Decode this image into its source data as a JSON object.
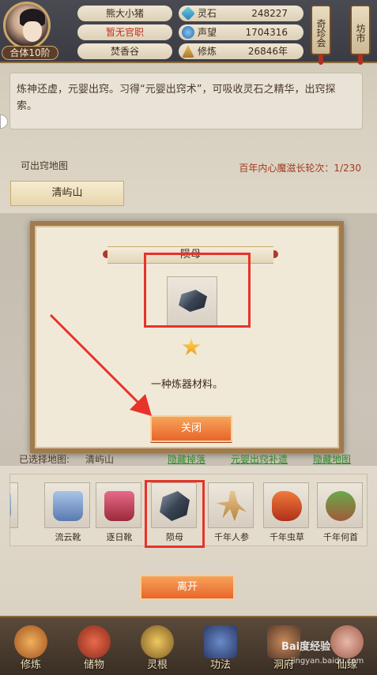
{
  "player": {
    "level": "合体10阶",
    "name": "熊大小猪",
    "title": "暂无官职",
    "sect": "焚香谷"
  },
  "resources": {
    "lingshi": {
      "label": "灵石",
      "value": "248227",
      "icon": "spirit-stone-icon"
    },
    "shengwang": {
      "label": "声望",
      "value": "1704316",
      "icon": "reputation-icon"
    },
    "xiulian": {
      "label": "修炼",
      "value": "26846年",
      "icon": "cultivation-icon"
    }
  },
  "top_buttons": {
    "qizhen": "奇珍会",
    "fangshi": "坊市"
  },
  "description": "炼神还虚，元婴出窍。习得“元婴出窍术”，可吸收灵石之精华，出窍探索。",
  "map_section": {
    "label": "可出窍地图",
    "progress": "百年内心魔滋长轮次：1/230",
    "map_button": "清屿山"
  },
  "modal": {
    "title": "陨母",
    "item_icon": "ore-icon",
    "description": "一种炼器材料。",
    "close_label": "关闭"
  },
  "selected": {
    "label": "已选择地图:",
    "map": "清屿山",
    "links": [
      "隐藏掉落",
      "元婴出窍补遗",
      "隐藏地图"
    ]
  },
  "items": [
    {
      "name": "流云靴",
      "icon": "boots-icon"
    },
    {
      "name": "逐日靴",
      "icon": "boots-icon"
    },
    {
      "name": "陨母",
      "icon": "ore-icon"
    },
    {
      "name": "千年人参",
      "icon": "ginseng-icon"
    },
    {
      "name": "千年虫草",
      "icon": "cordyceps-icon"
    },
    {
      "name": "千年何首",
      "icon": "herb-icon"
    }
  ],
  "leave_label": "离开",
  "nav": [
    {
      "label": "修炼",
      "icon": "cultivate-icon"
    },
    {
      "label": "储物",
      "icon": "bag-icon"
    },
    {
      "label": "灵根",
      "icon": "spirit-root-icon"
    },
    {
      "label": "功法",
      "icon": "book-icon"
    },
    {
      "label": "洞府",
      "icon": "cave-icon"
    },
    {
      "label": "仙缘",
      "icon": "fate-icon"
    }
  ],
  "watermark": {
    "main": "Bai度经验",
    "sub": "jingyan.baidu.com"
  },
  "colors": {
    "accent_orange": "#e8652a",
    "highlight_red": "#e8322a",
    "link_green": "#2d8a2a",
    "progress_red": "#a33a1e"
  }
}
